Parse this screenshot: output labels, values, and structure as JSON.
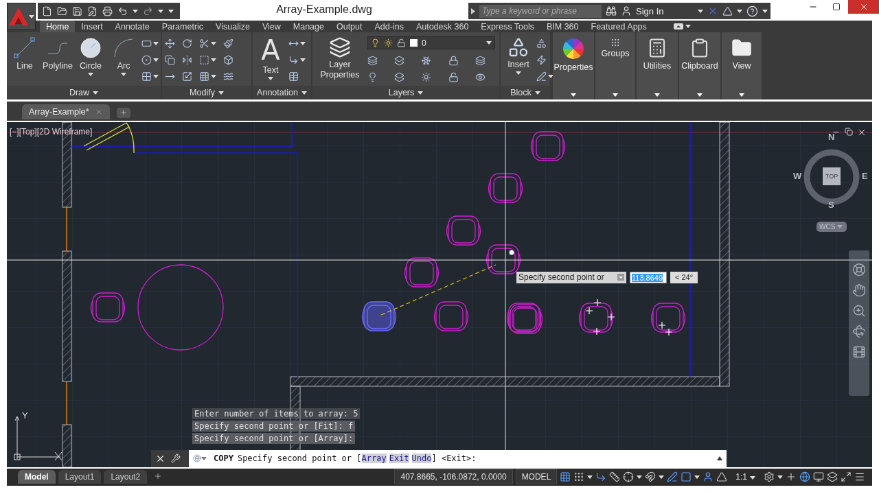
{
  "title_bar": {
    "title": "Array-Example.dwg",
    "search_placeholder": "Type a keyword or phrase",
    "sign_in": "Sign In"
  },
  "ribbon_tabs": [
    {
      "label": "Home",
      "selected": true
    },
    {
      "label": "Insert",
      "selected": false
    },
    {
      "label": "Annotate",
      "selected": false
    },
    {
      "label": "Parametric",
      "selected": false
    },
    {
      "label": "Visualize",
      "selected": false
    },
    {
      "label": "View",
      "selected": false
    },
    {
      "label": "Manage",
      "selected": false
    },
    {
      "label": "Output",
      "selected": false
    },
    {
      "label": "Add-ins",
      "selected": false
    },
    {
      "label": "Autodesk 360",
      "selected": false
    },
    {
      "label": "Express Tools",
      "selected": false
    },
    {
      "label": "BIM 360",
      "selected": false
    },
    {
      "label": "Featured Apps",
      "selected": false
    }
  ],
  "ribbon_panels": [
    {
      "kind": "tools",
      "title": "Draw",
      "large_tools": [
        {
          "label": "Line",
          "dropdown": false
        },
        {
          "label": "Polyline",
          "dropdown": false
        },
        {
          "label": "Circle",
          "dropdown": true
        },
        {
          "label": "Arc",
          "dropdown": true
        }
      ]
    },
    {
      "kind": "tools",
      "title": "Modify"
    },
    {
      "kind": "tools",
      "title": "Annotation",
      "large_tools": [
        {
          "label": "Text",
          "glyph": "A",
          "dropdown": true
        }
      ]
    },
    {
      "kind": "tools",
      "title": "Layers",
      "large_tools": [
        {
          "label": "Layer Properties",
          "dropdown": false
        }
      ],
      "layer": "0"
    },
    {
      "kind": "tools",
      "title": "Block",
      "large_tools": [
        {
          "label": "Insert",
          "dropdown": true
        }
      ]
    },
    {
      "kind": "slideout",
      "title": "Properties"
    },
    {
      "kind": "slideout",
      "title": "Groups"
    },
    {
      "kind": "slideout",
      "title": "Utilities"
    },
    {
      "kind": "slideout",
      "title": "Clipboard"
    },
    {
      "kind": "slideout",
      "title": "View"
    }
  ],
  "file_tabs": [
    {
      "label": "Array-Example*",
      "selected": true
    }
  ],
  "viewport": {
    "label": "[−][Top][2D Wireframe]",
    "ucs_axis_label": "Y",
    "viewcube": {
      "north": "N",
      "south": "S",
      "east": "E",
      "west": "W",
      "face": "TOP",
      "ucs": "WCS"
    },
    "tooltip": {
      "prompt": "Specify second point or",
      "distance": "113.8649",
      "angle": "< 24°"
    },
    "command_history": [
      "Enter number of items to array: 5",
      "Specify second point or [Fit]: f",
      "Specify second point or [Array]:"
    ]
  },
  "command_line": {
    "command": "COPY",
    "prompt": "Specify second point or [",
    "options": [
      "Array",
      "Exit",
      "Undo"
    ],
    "suffix": "] <Exit>:"
  },
  "layout_tabs": [
    {
      "label": "Model",
      "selected": true
    },
    {
      "label": "Layout1",
      "selected": false
    },
    {
      "label": "Layout2",
      "selected": false
    }
  ],
  "status_bar": {
    "coordinates": "407.8665, -106.0872, 0.0000",
    "space": "MODEL",
    "scale": "1:1"
  }
}
